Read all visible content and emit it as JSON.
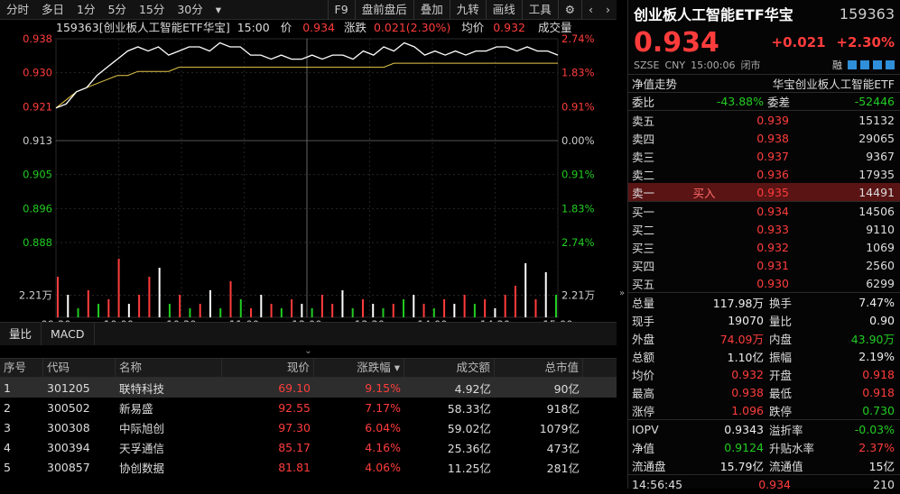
{
  "toolbar": {
    "left": [
      "分时",
      "多日",
      "1分",
      "5分",
      "15分",
      "30分"
    ],
    "right": [
      "F9",
      "盘前盘后",
      "叠加",
      "九转",
      "画线",
      "工具"
    ],
    "more": "▾"
  },
  "chart_header": {
    "code_name": "159363[创业板人工智能ETF华宝]",
    "time": "15:00",
    "price_label": "价",
    "price": "0.934",
    "change_label": "涨跌",
    "change": "0.021(2.30%)",
    "avg_label": "均价",
    "avg": "0.932",
    "vol_label": "成交量"
  },
  "chart_data": {
    "type": "line",
    "y_left": [
      "0.938",
      "0.930",
      "0.921",
      "0.913",
      "0.905",
      "0.896",
      "0.888"
    ],
    "y_right": [
      "2.74%",
      "1.83%",
      "0.91%",
      "0.00%",
      "0.91%",
      "1.83%",
      "2.74%"
    ],
    "x_ticks": [
      "09:30",
      "10:00",
      "10:30",
      "11:00",
      "13:00",
      "13:30",
      "14:00",
      "14:30",
      "15:00"
    ],
    "vol_tick": "2.21万",
    "ylim": [
      0.888,
      0.938
    ],
    "prev_close": 0.913,
    "price_series": [
      0.921,
      0.922,
      0.925,
      0.926,
      0.929,
      0.931,
      0.933,
      0.935,
      0.936,
      0.935,
      0.936,
      0.934,
      0.935,
      0.936,
      0.936,
      0.935,
      0.937,
      0.936,
      0.936,
      0.934,
      0.934,
      0.933,
      0.934,
      0.933,
      0.933,
      0.934,
      0.933,
      0.934,
      0.934,
      0.933,
      0.935,
      0.934,
      0.936,
      0.935,
      0.937,
      0.936,
      0.934,
      0.935,
      0.934,
      0.935,
      0.934,
      0.935,
      0.935,
      0.936,
      0.936,
      0.935,
      0.936,
      0.935,
      0.935,
      0.934
    ],
    "avg_series": [
      0.921,
      0.923,
      0.925,
      0.926,
      0.927,
      0.928,
      0.929,
      0.929,
      0.93,
      0.93,
      0.93,
      0.93,
      0.931,
      0.931,
      0.931,
      0.931,
      0.931,
      0.931,
      0.931,
      0.931,
      0.931,
      0.931,
      0.931,
      0.931,
      0.931,
      0.931,
      0.931,
      0.931,
      0.931,
      0.931,
      0.931,
      0.931,
      0.931,
      0.932,
      0.932,
      0.932,
      0.932,
      0.932,
      0.932,
      0.932,
      0.932,
      0.932,
      0.932,
      0.932,
      0.932,
      0.932,
      0.932,
      0.932,
      0.932,
      0.932
    ],
    "volumes": [
      0.9,
      0.5,
      0.2,
      0.6,
      0.3,
      0.4,
      1.3,
      0.3,
      0.5,
      0.9,
      1.1,
      0.3,
      0.5,
      0.2,
      0.3,
      0.6,
      0.2,
      0.8,
      0.4,
      0.2,
      0.5,
      0.3,
      0.2,
      0.4,
      0.3,
      0.2,
      0.5,
      0.3,
      0.6,
      0.2,
      0.4,
      0.3,
      0.2,
      0.3,
      0.4,
      0.5,
      0.3,
      0.2,
      0.4,
      0.3,
      0.5,
      0.3,
      0.4,
      0.2,
      0.5,
      0.7,
      1.2,
      0.4,
      1.0,
      0.5
    ],
    "volume_colors": [
      "red",
      "white",
      "green",
      "red",
      "green",
      "red",
      "red",
      "white",
      "red",
      "red",
      "white",
      "green",
      "red",
      "green",
      "red",
      "white",
      "green",
      "red",
      "green",
      "red",
      "white",
      "red",
      "green",
      "red",
      "white",
      "green",
      "red",
      "red",
      "white",
      "green",
      "red",
      "white",
      "green",
      "red",
      "green",
      "white",
      "red",
      "green",
      "red",
      "white",
      "red",
      "green",
      "red",
      "white",
      "red",
      "red",
      "white",
      "red",
      "white",
      "green"
    ]
  },
  "right_collapse": "»",
  "bottom_tabs": [
    "量比",
    "MACD"
  ],
  "bottom_collapse": "⌄",
  "table": {
    "headers": [
      "序号",
      "代码",
      "名称",
      "现价",
      "涨跌幅 ▾",
      "成交额",
      "总市值"
    ],
    "rows": [
      [
        "1",
        "301205",
        "联特科技",
        "69.10",
        "9.15%",
        "4.92亿",
        "90亿"
      ],
      [
        "2",
        "300502",
        "新易盛",
        "92.55",
        "7.17%",
        "58.33亿",
        "918亿"
      ],
      [
        "3",
        "300308",
        "中际旭创",
        "97.30",
        "6.04%",
        "59.02亿",
        "1079亿"
      ],
      [
        "4",
        "300394",
        "天孚通信",
        "85.17",
        "4.16%",
        "25.36亿",
        "473亿"
      ],
      [
        "5",
        "300857",
        "协创数据",
        "81.81",
        "4.06%",
        "11.25亿",
        "281亿"
      ]
    ]
  },
  "quote": {
    "name": "创业板人工智能ETF华宝",
    "code": "159363",
    "price": "0.934",
    "change": "+0.021",
    "pct": "+2.30%",
    "market": "SZSE",
    "currency": "CNY",
    "time": "15:00:06",
    "status": "闭市",
    "rong": "融",
    "trend_label": "净值走势",
    "trend_name": "华宝创业板人工智能ETF",
    "weibi_label": "委比",
    "weibi": "-43.88%",
    "weicha_label": "委差",
    "weicha": "-52446",
    "asks": [
      [
        "卖五",
        "",
        "0.939",
        "15132"
      ],
      [
        "卖四",
        "",
        "0.938",
        "29065"
      ],
      [
        "卖三",
        "",
        "0.937",
        "9367"
      ],
      [
        "卖二",
        "",
        "0.936",
        "17935"
      ],
      [
        "卖一",
        "买入",
        "0.935",
        "14491"
      ]
    ],
    "bids": [
      [
        "买一",
        "0.934",
        "14506"
      ],
      [
        "买二",
        "0.933",
        "9110"
      ],
      [
        "买三",
        "0.932",
        "1069"
      ],
      [
        "买四",
        "0.931",
        "2560"
      ],
      [
        "买五",
        "0.930",
        "6299"
      ]
    ],
    "stats": [
      [
        "总量",
        "117.98万",
        "white",
        "换手",
        "7.47%",
        "white"
      ],
      [
        "现手",
        "19070",
        "white",
        "量比",
        "0.90",
        "white"
      ],
      [
        "外盘",
        "74.09万",
        "red",
        "内盘",
        "43.90万",
        "green"
      ],
      [
        "总额",
        "1.10亿",
        "white",
        "振幅",
        "2.19%",
        "white"
      ],
      [
        "均价",
        "0.932",
        "red",
        "开盘",
        "0.918",
        "red"
      ],
      [
        "最高",
        "0.938",
        "red",
        "最低",
        "0.918",
        "red"
      ],
      [
        "涨停",
        "1.096",
        "red",
        "跌停",
        "0.730",
        "green"
      ]
    ],
    "stats2": [
      [
        "IOPV",
        "0.9343",
        "white",
        "溢折率",
        "-0.03%",
        "green"
      ],
      [
        "净值",
        "0.9124",
        "green",
        "升贴水率",
        "2.37%",
        "red"
      ],
      [
        "流通盘",
        "15.79亿",
        "white",
        "流通值",
        "15亿",
        "white"
      ]
    ],
    "tick": {
      "time": "14:56:45",
      "price": "0.934",
      "vol": "210"
    }
  }
}
